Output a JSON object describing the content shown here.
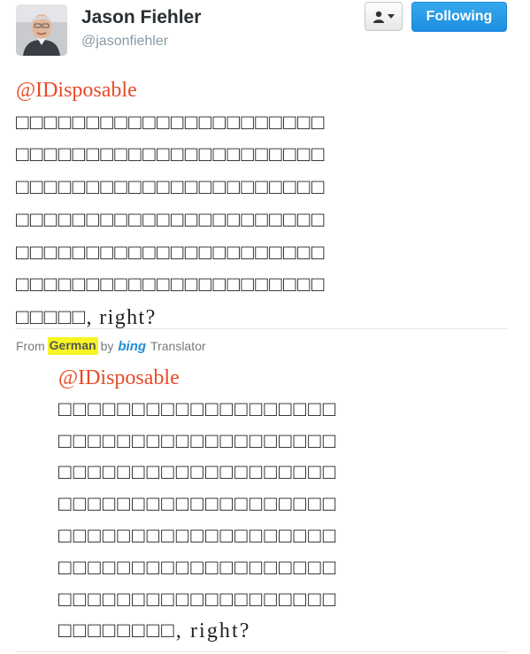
{
  "user": {
    "name": "Jason Fiehler",
    "handle": "@jasonfiehler"
  },
  "actions": {
    "user_menu_icon": "person-icon",
    "follow_label": "Following"
  },
  "tweet": {
    "mention": "@IDisposable",
    "lines": [
      "□□□□□□□□□□□□□□□□□□□□□□",
      "□□□□□□□□□□□□□□□□□□□□□□",
      "□□□□□□□□□□□□□□□□□□□□□□",
      "□□□□□□□□□□□□□□□□□□□□□□",
      "□□□□□□□□□□□□□□□□□□□□□□",
      "□□□□□□□□□□□□□□□□□□□□□□",
      "□□□□□, right?"
    ]
  },
  "translation": {
    "from_label": "From",
    "language": "German",
    "by_label": "by",
    "provider_logo": "bing",
    "service_label": "Translator",
    "mention": "@IDisposable",
    "lines": [
      "□□□□□□□□□□□□□□□□□□□",
      "□□□□□□□□□□□□□□□□□□□",
      "□□□□□□□□□□□□□□□□□□□",
      "□□□□□□□□□□□□□□□□□□□",
      "□□□□□□□□□□□□□□□□□□□",
      "□□□□□□□□□□□□□□□□□□□",
      "□□□□□□□□□□□□□□□□□□□",
      "□□□□□□□□, right?"
    ]
  },
  "colors": {
    "mention": "#e84a28",
    "follow_button": "#1c8ee0",
    "highlight": "#f6f523",
    "bing": "#1e8fd6"
  }
}
